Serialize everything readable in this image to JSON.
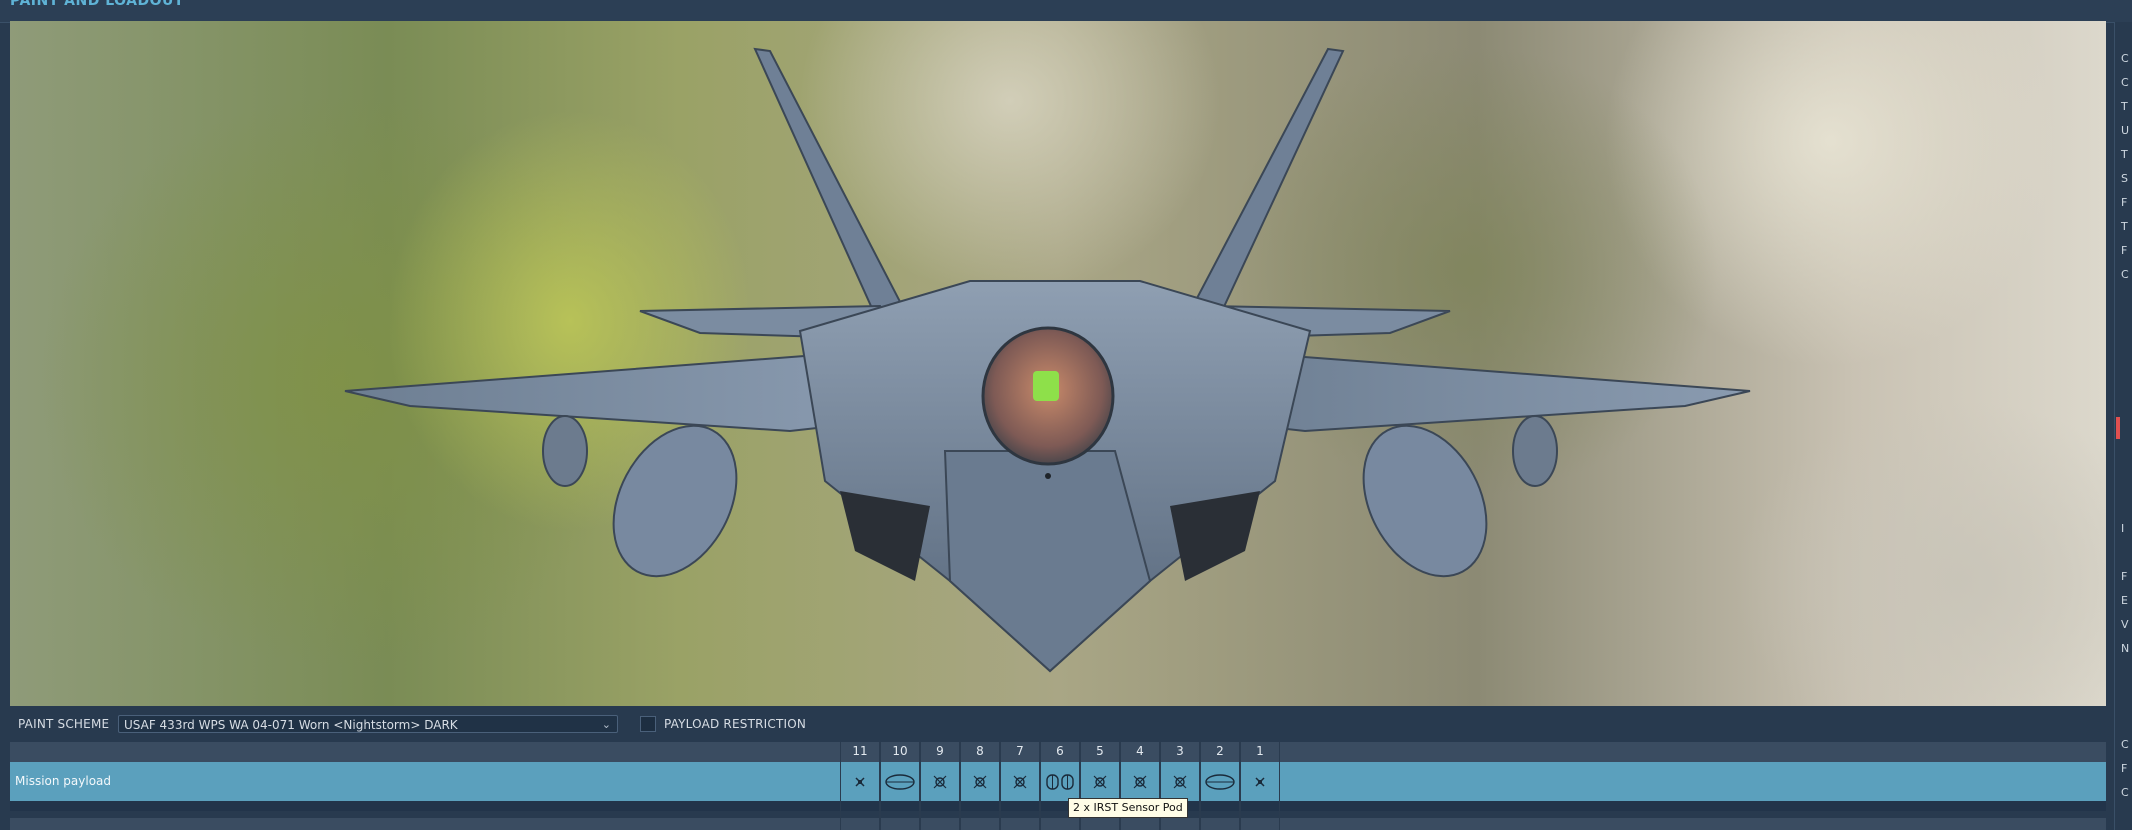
{
  "header": {
    "title": "PAINT AND LOADOUT"
  },
  "paint": {
    "label": "PAINT SCHEME",
    "selected": "USAF 433rd WPS WA 04-071 Worn <Nightstorm> DARK",
    "payload_restriction_label": "PAYLOAD RESTRICTION",
    "payload_restriction_checked": false
  },
  "payload": {
    "row_label": "Mission payload",
    "stations": [
      {
        "num": "11",
        "icon": "small-store-icon"
      },
      {
        "num": "10",
        "icon": "fuel-tank-icon"
      },
      {
        "num": "9",
        "icon": "missile-rack-icon"
      },
      {
        "num": "8",
        "icon": "missile-rack-icon"
      },
      {
        "num": "7",
        "icon": "missile-rack-icon"
      },
      {
        "num": "6",
        "icon": "sensor-pod-icon"
      },
      {
        "num": "5",
        "icon": "missile-rack-icon"
      },
      {
        "num": "4",
        "icon": "missile-rack-icon"
      },
      {
        "num": "3",
        "icon": "missile-rack-icon"
      },
      {
        "num": "2",
        "icon": "fuel-tank-icon"
      },
      {
        "num": "1",
        "icon": "small-store-icon"
      }
    ],
    "tooltip": "2 x IRST Sensor Pod"
  },
  "right_column_letters": [
    "C",
    "C",
    "T",
    "U",
    "T",
    "S",
    "F",
    "T",
    "F",
    "C",
    "",
    "",
    "",
    "",
    "",
    "I",
    "",
    "F",
    "E",
    "V",
    "N",
    "",
    "",
    "",
    "C",
    "F",
    "C"
  ],
  "colors": {
    "background": "#283a4f",
    "payload_row": "#5ba0bd",
    "accent_title": "#5fb3d6",
    "indicator": "#e05050"
  }
}
